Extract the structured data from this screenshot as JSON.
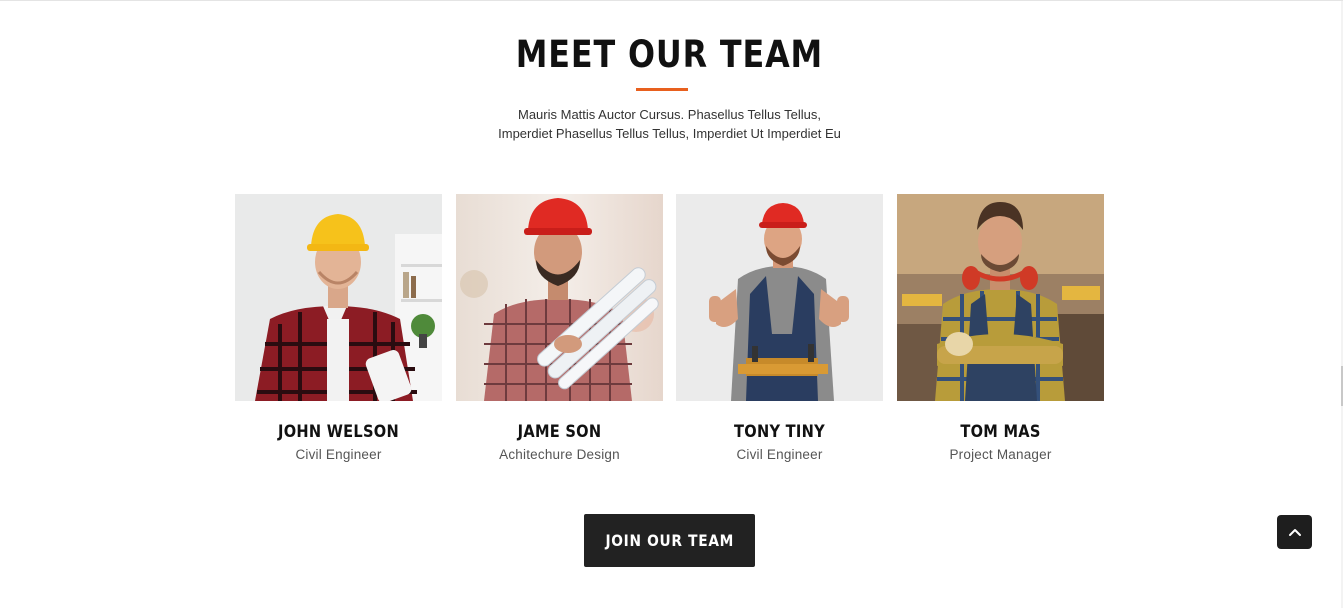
{
  "section": {
    "title": "MEET OUR TEAM",
    "intro_line1": "Mauris Mattis Auctor Cursus. Phasellus Tellus Tellus,",
    "intro_line2": "Imperdiet Phasellus Tellus Tellus, Imperdiet Ut Imperdiet Eu",
    "accent_color": "#e8601e"
  },
  "team": [
    {
      "name": "JOHN WELSON",
      "role": "Civil Engineer",
      "helmet_color": "#f6c21b",
      "photo_icon": "worker-photo"
    },
    {
      "name": "JAME SON",
      "role": "Achitechure Design",
      "helmet_color": "#e02a23",
      "photo_icon": "worker-photo"
    },
    {
      "name": "TONY TINY",
      "role": "Civil Engineer",
      "helmet_color": "#e02a23",
      "photo_icon": "worker-photo"
    },
    {
      "name": "TOM MAS",
      "role": "Project Manager",
      "helmet_color": "none",
      "photo_icon": "worker-photo"
    }
  ],
  "cta": {
    "label": "JOIN OUR TEAM"
  },
  "back_to_top": {
    "icon": "chevron-up-icon"
  }
}
